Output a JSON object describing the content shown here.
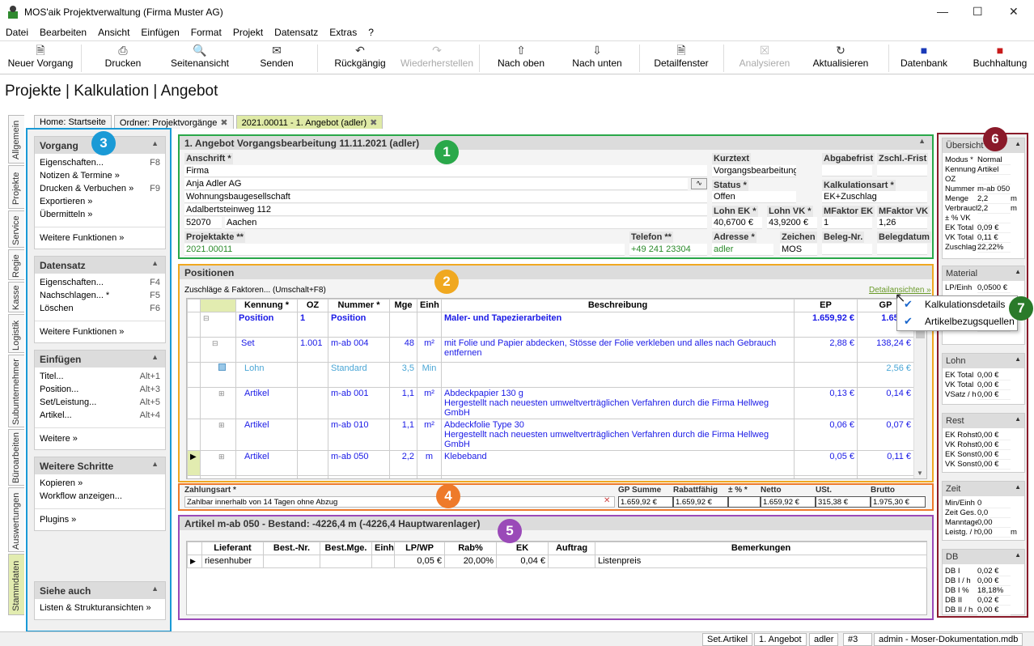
{
  "window": {
    "title": "MOS'aik Projektverwaltung (Firma Muster AG)"
  },
  "menu": [
    "Datei",
    "Bearbeiten",
    "Ansicht",
    "Einfügen",
    "Format",
    "Projekt",
    "Datensatz",
    "Extras",
    "?"
  ],
  "toolbar": {
    "new": "Neuer Vorgang",
    "print": "Drucken",
    "preview": "Seitenansicht",
    "send": "Senden",
    "undo": "Rückgängig",
    "redo": "Wiederherstellen",
    "up": "Nach oben",
    "down": "Nach unten",
    "detail": "Detailfenster",
    "analyze": "Analysieren",
    "refresh": "Aktualisieren",
    "db": "Datenbank",
    "accounting": "Buchhaltung"
  },
  "heading": "Projekte | Kalkulation | Angebot",
  "vtabs": [
    "Allgemein",
    "Projekte",
    "Service",
    "Regie",
    "Kasse",
    "Logistik",
    "Subunternehmer",
    "Büroarbeiten",
    "Auswertungen",
    "Stammdaten"
  ],
  "doctabs": [
    "Home: Startseite",
    "Ordner: Projektvorgänge",
    "2021.00011 - 1. Angebot (adler)"
  ],
  "sidebar": {
    "vorgang": {
      "title": "Vorgang",
      "items": [
        {
          "l": "Eigenschaften...",
          "k": "F8"
        },
        {
          "l": "Notizen & Termine »",
          "k": ""
        },
        {
          "l": "Drucken & Verbuchen »",
          "k": "F9"
        },
        {
          "l": "Exportieren »",
          "k": ""
        },
        {
          "l": "Übermitteln »",
          "k": ""
        }
      ],
      "more": "Weitere Funktionen »"
    },
    "datensatz": {
      "title": "Datensatz",
      "items": [
        {
          "l": "Eigenschaften...",
          "k": "F4"
        },
        {
          "l": "Nachschlagen... *",
          "k": "F5"
        },
        {
          "l": "Löschen",
          "k": "F6"
        }
      ],
      "more": "Weitere Funktionen »"
    },
    "einfuegen": {
      "title": "Einfügen",
      "items": [
        {
          "l": "Titel...",
          "k": "Alt+1"
        },
        {
          "l": "Position...",
          "k": "Alt+3"
        },
        {
          "l": "Set/Leistung...",
          "k": "Alt+5"
        },
        {
          "l": "Artikel...",
          "k": "Alt+4"
        }
      ],
      "more": "Weitere »"
    },
    "schritte": {
      "title": "Weitere Schritte",
      "items": [
        {
          "l": "Kopieren »",
          "k": ""
        },
        {
          "l": "Workflow anzeigen...",
          "k": ""
        }
      ],
      "more": "Plugins »"
    },
    "siehe": {
      "title": "Siehe auch",
      "items": [
        {
          "l": "Listen & Strukturansichten »",
          "k": ""
        }
      ]
    }
  },
  "badges": {
    "b1": "1",
    "b2": "2",
    "b3": "3",
    "b4": "4",
    "b5": "5",
    "b6": "6",
    "b7": "7"
  },
  "header_panel": {
    "title": "1. Angebot Vorgangsbearbeitung 11.11.2021 (adler)",
    "anschrift_label": "Anschrift *",
    "address": [
      "Firma",
      "Anja Adler AG",
      "Wohnungsbaugesellschaft",
      "Adalbertsteinweg 112"
    ],
    "zip": "52070",
    "city": "Aachen",
    "kurztext_label": "Kurztext",
    "kurztext": "Vorgangsbearbeitung",
    "abgabefrist_label": "Abgabefrist",
    "zschl_label": "Zschl.-Frist",
    "status_label": "Status *",
    "status": "Offen",
    "kalkart_label": "Kalkulationsart *",
    "kalkart": "EK+Zuschlag",
    "lohnek_label": "Lohn EK *",
    "lohnek": "40,6700 €",
    "lohnvk_label": "Lohn VK *",
    "lohnvk": "43,9200 €",
    "mfek_label": "MFaktor EK",
    "mfek": "1",
    "mfvk_label": "MFaktor VK",
    "mfvk": "1,26",
    "projektakte_label": "Projektakte **",
    "projektakte": "2021.00011",
    "telefon_label": "Telefon **",
    "telefon": "+49 241 23304",
    "adresse_label": "Adresse *",
    "adresse": "adler",
    "zeichen_label": "Zeichen",
    "zeichen": "MOS",
    "belegnr_label": "Beleg-Nr.",
    "belegdatum_label": "Belegdatum"
  },
  "positions": {
    "title": "Positionen",
    "sub": "Zuschläge & Faktoren... (Umschalt+F8)",
    "detail_link": "Detailansichten »",
    "cols": [
      "Kennung *",
      "OZ",
      "Nummer *",
      "Mge",
      "Einh",
      "Beschreibung",
      "EP",
      "GP"
    ],
    "rows": [
      {
        "k": "Position",
        "oz": "1",
        "n": "Position",
        "m": "",
        "e": "",
        "d": "Maler- und Tapezierarbeiten",
        "d2": "",
        "ep": "1.659,92 €",
        "gp": "1.659,9",
        "style": "pos"
      },
      {
        "k": "Set",
        "oz": "1.001",
        "n": "m-ab 004",
        "m": "48",
        "e": "m²",
        "d": "mit Folie und Papier abdecken, Stösse der Folie verkleben und alles nach Gebrauch",
        "d2": "entfernen",
        "ep": "2,88 €",
        "gp": "138,24 €",
        "style": "set"
      },
      {
        "k": "Lohn",
        "oz": "",
        "n": "Standard",
        "m": "3,5",
        "e": "Min",
        "d": "",
        "d2": "",
        "ep": "",
        "gp": "2,56 €",
        "style": "lohn"
      },
      {
        "k": "Artikel",
        "oz": "",
        "n": "m-ab 001",
        "m": "1,1",
        "e": "m²",
        "d": "Abdeckpapier 130 g",
        "d2": "Hergestellt nach neuesten umweltverträglichen Verfahren durch die Firma Hellweg GmbH",
        "ep": "0,13 €",
        "gp": "0,14 €",
        "style": "art"
      },
      {
        "k": "Artikel",
        "oz": "",
        "n": "m-ab 010",
        "m": "1,1",
        "e": "m²",
        "d": "Abdeckfolie Type 30",
        "d2": "Hergestellt nach neuesten umweltverträglichen Verfahren durch die Firma Hellweg GmbH",
        "ep": "0,06 €",
        "gp": "0,07 €",
        "style": "art"
      },
      {
        "k": "Artikel",
        "oz": "",
        "n": "m-ab 050",
        "m": "2,2",
        "e": "m",
        "d": "Klebeband",
        "d2": "",
        "ep": "0,05 €",
        "gp": "0,11 €",
        "style": "art"
      },
      {
        "k": "...",
        "oz": "",
        "n": "",
        "m": "",
        "e": "",
        "d": "...",
        "d2": "",
        "ep": "",
        "gp": "",
        "style": "more"
      }
    ]
  },
  "totals": {
    "zahlungsart_label": "Zahlungsart *",
    "zahlungsart": "Zahlbar innerhalb von 14 Tagen ohne Abzug",
    "labels": [
      "GP Summe",
      "Rabattfähig",
      "± % *",
      "Netto",
      "USt.",
      "Brutto"
    ],
    "values": [
      "1.659,92 €",
      "1.659,92 €",
      "",
      "1.659,92 €",
      "315,38 €",
      "1.975,30 €"
    ]
  },
  "article": {
    "title": "Artikel m-ab 050 - Bestand: -4226,4 m (-4226,4 Hauptwarenlager)",
    "cols": [
      "Lieferant",
      "Best.-Nr.",
      "Best.Mge.",
      "Einh",
      "LP/WP",
      "Rab%",
      "EK",
      "Auftrag",
      "Bemerkungen"
    ],
    "row": [
      "riesenhuber",
      "",
      "",
      "",
      "0,05 €",
      "20,00%",
      "0,04 €",
      "",
      "Listenpreis"
    ]
  },
  "right": {
    "uebersicht": {
      "title": "Übersicht",
      "rows": [
        [
          "Modus *",
          "Normal",
          ""
        ],
        [
          "Kennung",
          "Artikel",
          ""
        ],
        [
          "OZ",
          "",
          ""
        ],
        [
          "Nummer",
          "m-ab 050",
          ""
        ],
        [
          "Menge",
          "2,2",
          "m"
        ],
        [
          "Verbrauch",
          "2,2",
          "m"
        ],
        [
          "± % VK",
          "",
          ""
        ],
        [
          "EK Total",
          "0,09 €",
          ""
        ],
        [
          "VK Total",
          "0,11 €",
          ""
        ],
        [
          "Zuschlag",
          "22,22%",
          ""
        ]
      ]
    },
    "material": {
      "title": "Material",
      "rows": [
        [
          "LP/Einh",
          "0,0500 €",
          ""
        ],
        [
          "",
          "",
          ""
        ],
        [
          "",
          "",
          ""
        ],
        [
          "",
          "",
          ""
        ],
        [
          "Faktor",
          "1,22",
          ""
        ]
      ]
    },
    "lohn": {
      "title": "Lohn",
      "rows": [
        [
          "EK Total",
          "0,00 €",
          ""
        ],
        [
          "VK Total",
          "0,00 €",
          ""
        ],
        [
          "VSatz / h",
          "0,00 €",
          ""
        ]
      ]
    },
    "rest": {
      "title": "Rest",
      "rows": [
        [
          "EK Rohst.",
          "0,00 €",
          ""
        ],
        [
          "VK Rohst.",
          "0,00 €",
          ""
        ],
        [
          "EK Sonst.",
          "0,00 €",
          ""
        ],
        [
          "VK Sonst.",
          "0,00 €",
          ""
        ]
      ]
    },
    "zeit": {
      "title": "Zeit",
      "rows": [
        [
          "Min/Einh",
          "0",
          ""
        ],
        [
          "Zeit Ges.",
          "0,0",
          ""
        ],
        [
          "Manntage",
          "0,00",
          ""
        ],
        [
          "Leistg. / h",
          "0,00",
          "m"
        ]
      ]
    },
    "db": {
      "title": "DB",
      "rows": [
        [
          "DB I",
          "0,02 €",
          ""
        ],
        [
          "DB I / h",
          "0,00 €",
          ""
        ],
        [
          "DB I %",
          "18,18%",
          ""
        ],
        [
          "DB II",
          "0,02 €",
          ""
        ],
        [
          "DB II / h",
          "0,00 €",
          ""
        ]
      ]
    }
  },
  "popup": [
    "Kalkulationsdetails",
    "Artikelbezugsquellen"
  ],
  "status": [
    "Set.Artikel",
    "1. Angebot",
    "adler",
    "#3",
    "admin - Moser-Dokumentation.mdb"
  ]
}
